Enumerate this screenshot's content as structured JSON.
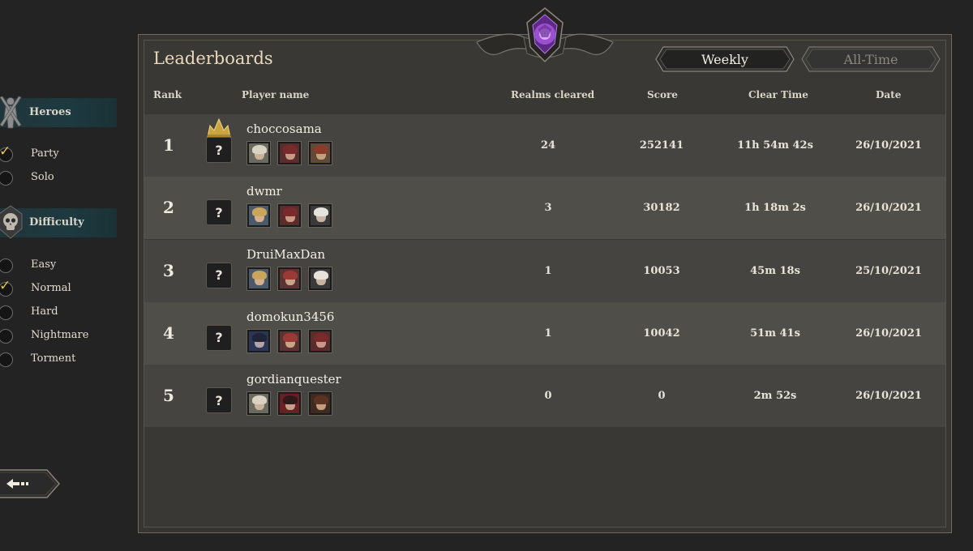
{
  "sidebar": {
    "heroes": {
      "header": "Heroes",
      "options": [
        {
          "label": "Party",
          "checked": true
        },
        {
          "label": "Solo",
          "checked": false
        }
      ]
    },
    "difficulty": {
      "header": "Difficulty",
      "options": [
        {
          "label": "Easy",
          "checked": false
        },
        {
          "label": "Normal",
          "checked": true
        },
        {
          "label": "Hard",
          "checked": false
        },
        {
          "label": "Nightmare",
          "checked": false
        },
        {
          "label": "Torment",
          "checked": false
        }
      ]
    },
    "check_mark": "✓"
  },
  "leaderboard": {
    "title": "Leaderboards",
    "tabs": [
      {
        "label": "Weekly",
        "active": true
      },
      {
        "label": "All-Time",
        "active": false
      }
    ],
    "columns": {
      "rank": "Rank",
      "player": "Player name",
      "realms": "Realms cleared",
      "score": "Score",
      "clear_time": "Clear Time",
      "date": "Date"
    },
    "unknown_badge": "?",
    "rows": [
      {
        "rank": "1",
        "player": "choccosama",
        "realms": "24",
        "score": "252141",
        "clear_time": "11h 54m 42s",
        "date": "26/10/2021",
        "crown": true,
        "heroes": [
          "pale-haired-hero",
          "red-haired-hero",
          "red-hooded-hero"
        ]
      },
      {
        "rank": "2",
        "player": "dwmr",
        "realms": "3",
        "score": "30182",
        "clear_time": "1h 18m 2s",
        "date": "26/10/2021",
        "crown": false,
        "heroes": [
          "blonde-hero",
          "red-haired-hero",
          "white-bearded-hero"
        ]
      },
      {
        "rank": "3",
        "player": "DruiMaxDan",
        "realms": "1",
        "score": "10053",
        "clear_time": "45m 18s",
        "date": "25/10/2021",
        "crown": false,
        "heroes": [
          "blonde-hero",
          "red-hat-hero",
          "white-bearded-hero"
        ]
      },
      {
        "rank": "4",
        "player": "domokun3456",
        "realms": "1",
        "score": "10042",
        "clear_time": "51m 41s",
        "date": "26/10/2021",
        "crown": false,
        "heroes": [
          "dark-haired-hero",
          "red-hat-hero",
          "red-haired-hero"
        ]
      },
      {
        "rank": "5",
        "player": "gordianquester",
        "realms": "0",
        "score": "0",
        "clear_time": "2m 52s",
        "date": "26/10/2021",
        "crown": false,
        "heroes": [
          "pale-haired-hero",
          "dark-red-hero",
          "brown-haired-hero"
        ]
      }
    ]
  },
  "back_button": "back-arrow-icon",
  "colors": {
    "accent_gold": "#e6c74a",
    "sidebar_header": "#1d3a41",
    "emblem_purple": "#9b4fd1"
  }
}
